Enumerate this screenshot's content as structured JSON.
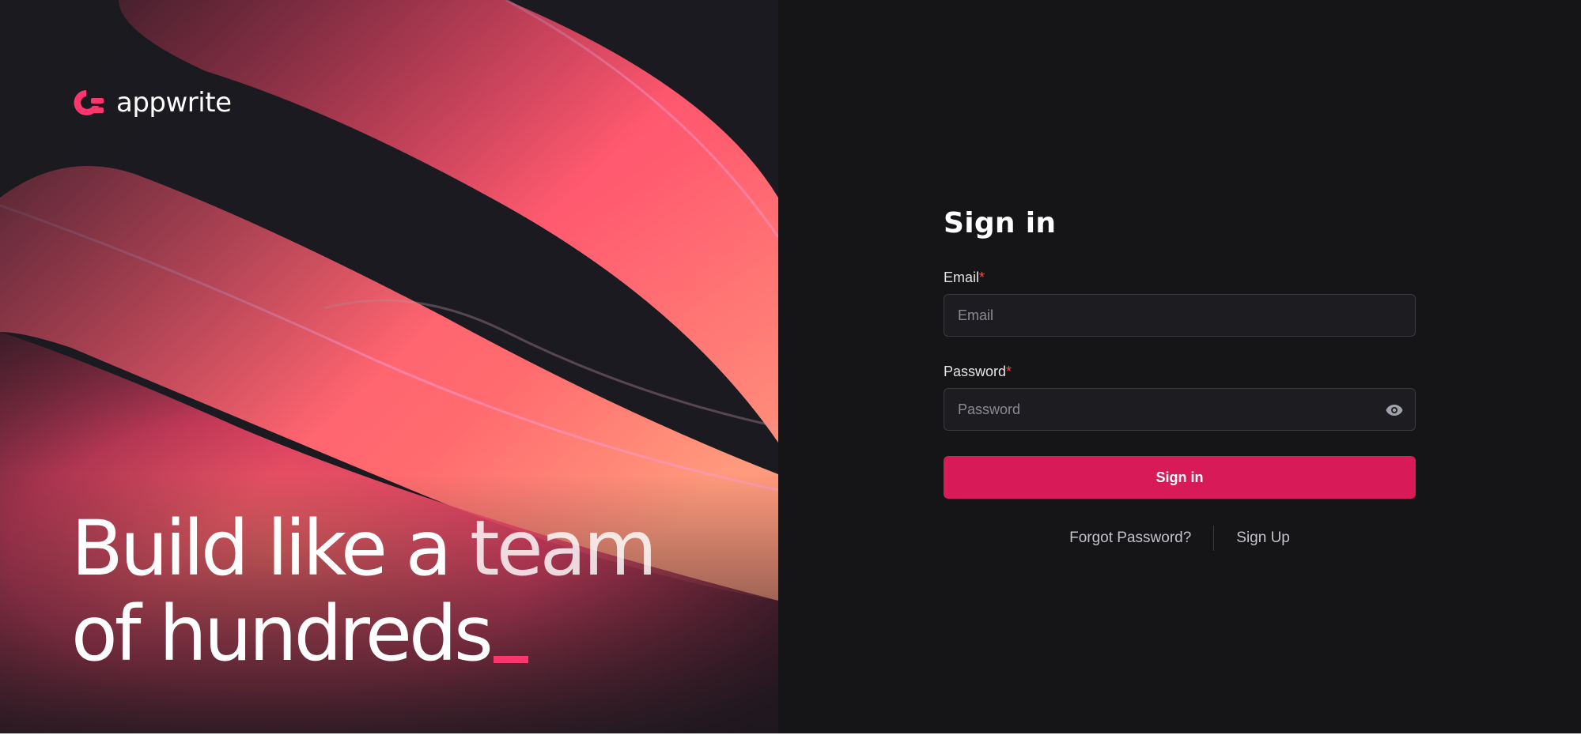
{
  "brand": {
    "name": "appwrite",
    "icon": "appwrite-logo-icon",
    "accent": "#fd366e"
  },
  "hero": {
    "headline_line1_a": "Build like a ",
    "headline_line1_b": "team",
    "headline_line2": "of hundreds"
  },
  "form": {
    "title": "Sign in",
    "email": {
      "label": "Email",
      "required_mark": "*",
      "placeholder": "Email",
      "value": ""
    },
    "password": {
      "label": "Password",
      "required_mark": "*",
      "placeholder": "Password",
      "value": "",
      "toggle_icon": "eye-icon"
    },
    "submit_label": "Sign in",
    "button_color": "#d81b58"
  },
  "links": {
    "forgot": "Forgot Password?",
    "signup": "Sign Up"
  }
}
